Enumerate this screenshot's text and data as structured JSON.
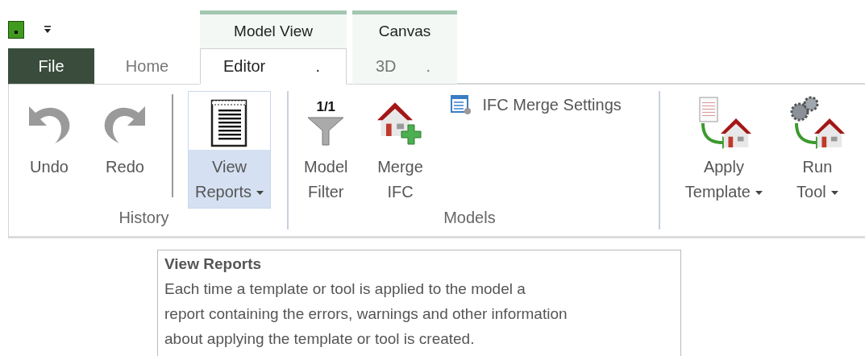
{
  "tabs": [
    {
      "label": "File",
      "kind": "file",
      "selected": false
    },
    {
      "label": "Home",
      "kind": "plain",
      "selected": false
    },
    {
      "label": "Editor",
      "kind": "contextual",
      "group": "Model View",
      "suffix": ".",
      "selected": true
    },
    {
      "label": "3D",
      "kind": "contextual",
      "group": "Canvas",
      "suffix": ".",
      "selected": false
    }
  ],
  "ribbon_groups": [
    {
      "label": "History",
      "items": [
        {
          "kind": "large",
          "lines": [
            "Undo"
          ],
          "disabled": true
        },
        {
          "kind": "large",
          "lines": [
            "Redo"
          ],
          "disabled": true
        },
        {
          "kind": "separator"
        },
        {
          "kind": "large",
          "lines": [
            "View",
            "Reports"
          ],
          "dropdown": true,
          "highlighted": true
        }
      ]
    },
    {
      "label": "Models",
      "items": [
        {
          "kind": "large",
          "lines": [
            "Model",
            "Filter"
          ],
          "badge": "1/1"
        },
        {
          "kind": "large",
          "lines": [
            "Merge",
            "IFC"
          ]
        },
        {
          "kind": "small",
          "lines": [
            "IFC Merge Settings"
          ]
        }
      ]
    },
    {
      "items": [
        {
          "kind": "large",
          "lines": [
            "Apply",
            "Template"
          ],
          "dropdown": true
        },
        {
          "kind": "large",
          "lines": [
            "Run",
            "Tool"
          ],
          "dropdown": true
        }
      ]
    }
  ],
  "tooltip": {
    "title": "View Reports",
    "lines": [
      "Each time a template or tool is applied to the model a",
      "report containing the errors, warnings and other information",
      "about applying the template or tool is created."
    ]
  }
}
